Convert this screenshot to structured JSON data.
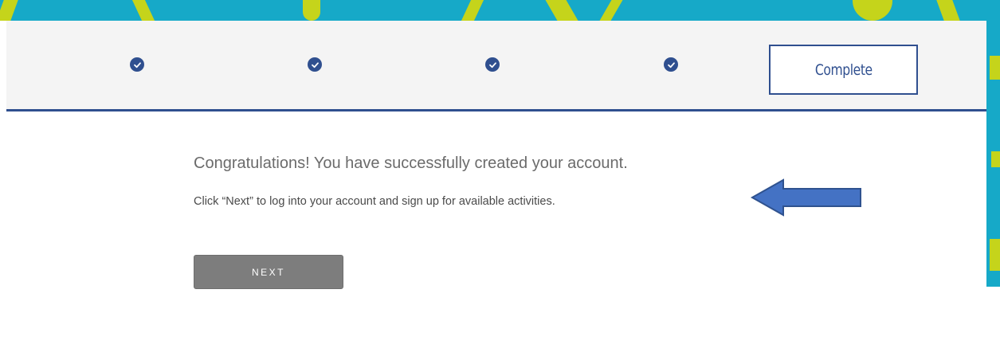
{
  "stepper": {
    "completed_icon": "check-circle-icon",
    "current_step_label": "Complete"
  },
  "content": {
    "congrats_text": "Congratulations! You have successfully created your account.",
    "instruction_text": "Click “Next” to log into your account and sign up for available activities.",
    "next_button_label": "NEXT"
  },
  "annotation": {
    "icon": "left-arrow-icon",
    "color": "#4472c4"
  },
  "colors": {
    "accent": "#2f4f8f",
    "background_band": "#16a9c8",
    "background_shape": "#c5d41b",
    "button": "#7d7d7d"
  }
}
